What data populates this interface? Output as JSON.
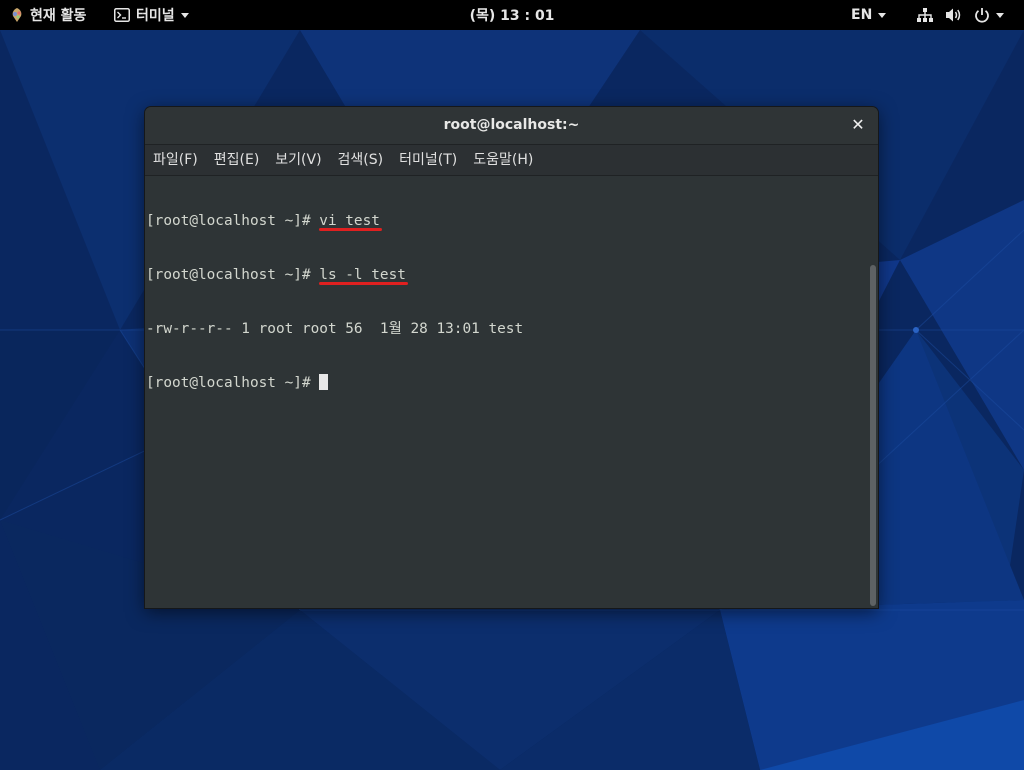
{
  "topbar": {
    "activities_label": "현재 활동",
    "app_menu_label": "터미널",
    "clock": "(목) 13 : 01",
    "language": "EN"
  },
  "terminal": {
    "title": "root@localhost:~",
    "menu": [
      {
        "label": "파일(F)"
      },
      {
        "label": "편집(E)"
      },
      {
        "label": "보기(V)"
      },
      {
        "label": "검색(S)"
      },
      {
        "label": "터미널(T)"
      },
      {
        "label": "도움말(H)"
      }
    ],
    "lines": [
      {
        "prompt": "[root@localhost ~]# ",
        "command": "vi test"
      },
      {
        "prompt": "[root@localhost ~]# ",
        "command": "ls -l test"
      },
      {
        "output": "-rw-r--r-- 1 root root 56  1월 28 13:01 test"
      },
      {
        "prompt": "[root@localhost ~]# "
      }
    ]
  },
  "icons": {
    "activities": "activities-icon",
    "app_menu": "terminal-app-icon",
    "network": "network-icon",
    "volume": "volume-icon",
    "power": "power-icon",
    "close": "close-icon"
  },
  "colors": {
    "desktop": "#0b2a63",
    "topbar": "#000000",
    "terminal_bg": "#2e3436",
    "terminal_text": "#d3d7cf",
    "annotation_underline": "#e02020"
  }
}
